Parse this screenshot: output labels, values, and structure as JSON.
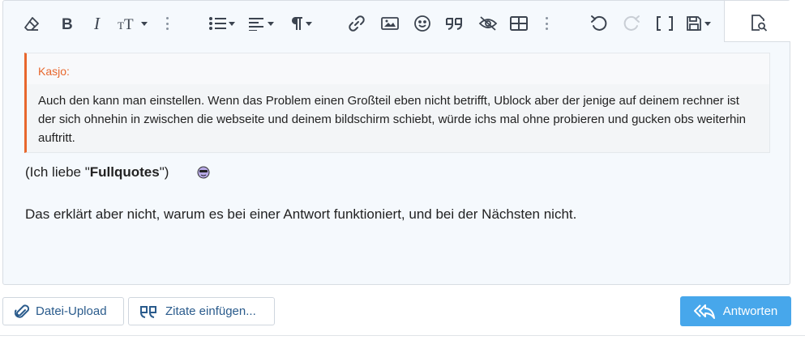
{
  "toolbar": {
    "icons": [
      "eraser-icon",
      "bold-icon",
      "italic-icon",
      "text-size-icon",
      "more-icon",
      "list-icon",
      "align-icon",
      "paragraph-icon",
      "more-icon",
      "link-icon",
      "image-icon",
      "smiley-icon",
      "quote-icon",
      "spoiler-icon",
      "table-icon",
      "more-icon",
      "undo-icon",
      "redo-icon",
      "brackets-icon",
      "save-icon",
      "preview-icon"
    ]
  },
  "quote": {
    "author": "Kasjo:",
    "text": "Auch den kann man einstellen. Wenn das Problem einen Großteil eben nicht betrifft, Ublock aber der jenige auf deinem rechner ist der sich ohnehin in zwischen die webseite und deinem bildschirm schiebt, würde ichs mal ohne probieren und gucken obs weiterhin auftritt."
  },
  "post": {
    "line1_prefix": "(Ich liebe \"",
    "line1_bold": "Fullquotes",
    "line1_suffix": "\")",
    "line2": "Das erklärt aber nicht, warum es bei einer Antwort funktioniert, und bei der Nächsten nicht."
  },
  "buttons": {
    "upload": "Datei-Upload",
    "insert_quotes": "Zitate einfügen...",
    "reply": "Antworten"
  },
  "colors": {
    "accent": "#e8672d",
    "primary": "#47a7eb",
    "link": "#2a5b8c"
  }
}
